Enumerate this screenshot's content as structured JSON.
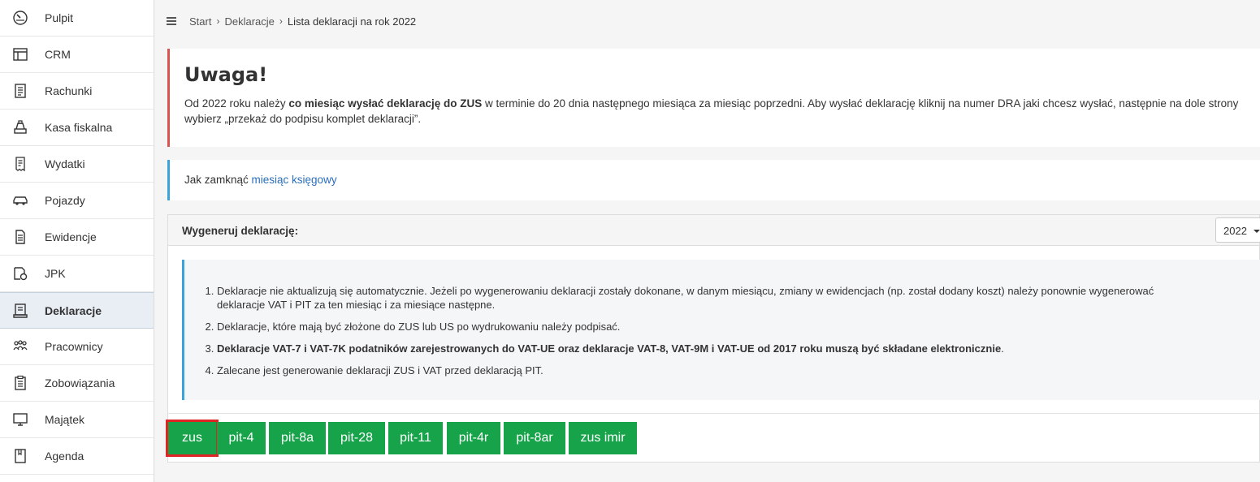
{
  "sidebar": {
    "items": [
      {
        "label": "Pulpit",
        "icon": "gauge-icon"
      },
      {
        "label": "CRM",
        "icon": "layout-icon"
      },
      {
        "label": "Rachunki",
        "icon": "invoice-icon"
      },
      {
        "label": "Kasa fiskalna",
        "icon": "cash-register-icon"
      },
      {
        "label": "Wydatki",
        "icon": "receipt-icon"
      },
      {
        "label": "Pojazdy",
        "icon": "car-icon"
      },
      {
        "label": "Ewidencje",
        "icon": "document-icon"
      },
      {
        "label": "JPK",
        "icon": "file-settings-icon"
      },
      {
        "label": "Deklaracje",
        "icon": "declaration-icon"
      },
      {
        "label": "Pracownicy",
        "icon": "people-icon"
      },
      {
        "label": "Zobowiązania",
        "icon": "clipboard-icon"
      },
      {
        "label": "Majątek",
        "icon": "monitor-icon"
      },
      {
        "label": "Agenda",
        "icon": "notebook-icon"
      }
    ],
    "active": "Deklaracje"
  },
  "breadcrumb": {
    "start": "Start",
    "deklaracje": "Deklaracje",
    "current": "Lista deklaracji na rok 2022"
  },
  "warning": {
    "title": "Uwaga!",
    "text_before": "Od 2022 roku należy ",
    "text_bold": "co miesiąc wysłać deklarację do ZUS",
    "text_after": " w terminie do 20 dnia następnego miesiąca za miesiąc poprzedni. Aby wysłać deklarację kliknij na numer DRA jaki chcesz wysłać, następnie na dole strony wybierz „przekaż do podpisu komplet deklaracji”."
  },
  "info": {
    "text": "Jak zamknąć ",
    "link": "miesiąc księgowy"
  },
  "panel": {
    "title": "Wygeneruj deklarację:",
    "year": "2022",
    "notes": [
      {
        "text": "Deklaracje nie aktualizują się automatycznie. Jeżeli po wygenerowaniu deklaracji zostały dokonane, w danym miesiącu, zmiany w ewidencjach (np. został dodany koszt) należy ponownie wygenerować deklaracje VAT i PIT za ten miesiąc i za miesiące następne.",
        "bold": ""
      },
      {
        "text": "Deklaracje, które mają być złożone do ZUS lub US po wydrukowaniu należy podpisać.",
        "bold": ""
      },
      {
        "text": ".",
        "bold": "Deklaracje VAT-7 i VAT-7K podatników zarejestrowanych do VAT-UE oraz deklaracje VAT-8, VAT-9M i VAT-UE od 2017 roku muszą być składane elektronicznie"
      },
      {
        "text": "Zalecane jest generowanie deklaracji ZUS i VAT przed deklaracją PIT.",
        "bold": ""
      }
    ],
    "buttons": [
      "zus",
      "pit-4",
      "pit-8a",
      "pit-28",
      "pit-11",
      "pit-4r",
      "pit-8ar",
      "zus imir"
    ],
    "selected_button": "zus",
    "button_color": "#17a34a",
    "highlight_color": "#e02424"
  }
}
